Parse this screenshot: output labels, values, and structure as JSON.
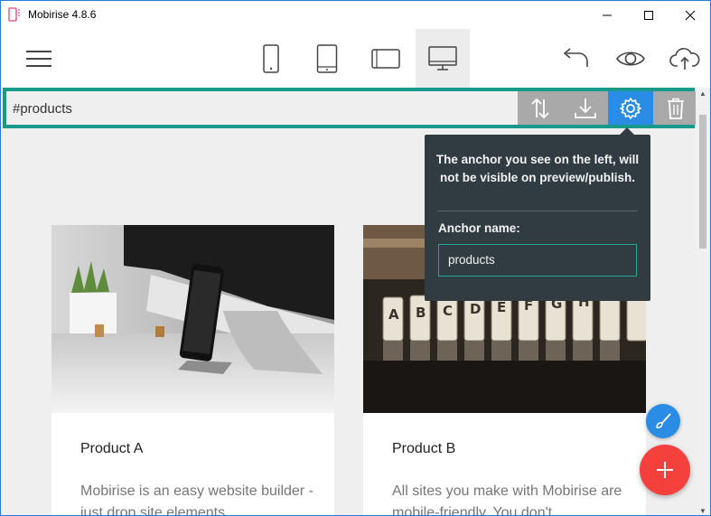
{
  "window": {
    "title": "Mobirise 4.8.6"
  },
  "toolbar": {
    "menu_icon": "hamburger-menu-icon",
    "devices": [
      "phone-icon",
      "tablet-icon",
      "tablet-landscape-icon",
      "desktop-icon"
    ],
    "active_device": "desktop",
    "undo_icon": "undo-icon",
    "preview_icon": "eye-icon",
    "publish_icon": "cloud-upload-icon"
  },
  "block": {
    "anchor_text": "#products",
    "tools": [
      "reorder-icon",
      "download-icon",
      "gear-icon",
      "trash-icon"
    ],
    "active_tool": "gear"
  },
  "popover": {
    "note": "The anchor you see on the left, will not be visible on preview/publish.",
    "label": "Anchor name:",
    "input_value": "products"
  },
  "cards": [
    {
      "title": "Product A",
      "text": "Mobirise is an easy website builder - just drop site elements"
    },
    {
      "title": "Product B",
      "text": "All sites you make with Mobirise are mobile-friendly. You don't"
    }
  ],
  "colors": {
    "accent_teal": "#179a8c",
    "active_blue": "#2b8ce6",
    "popover_bg": "#303c41",
    "fab_red": "#f4413d"
  }
}
